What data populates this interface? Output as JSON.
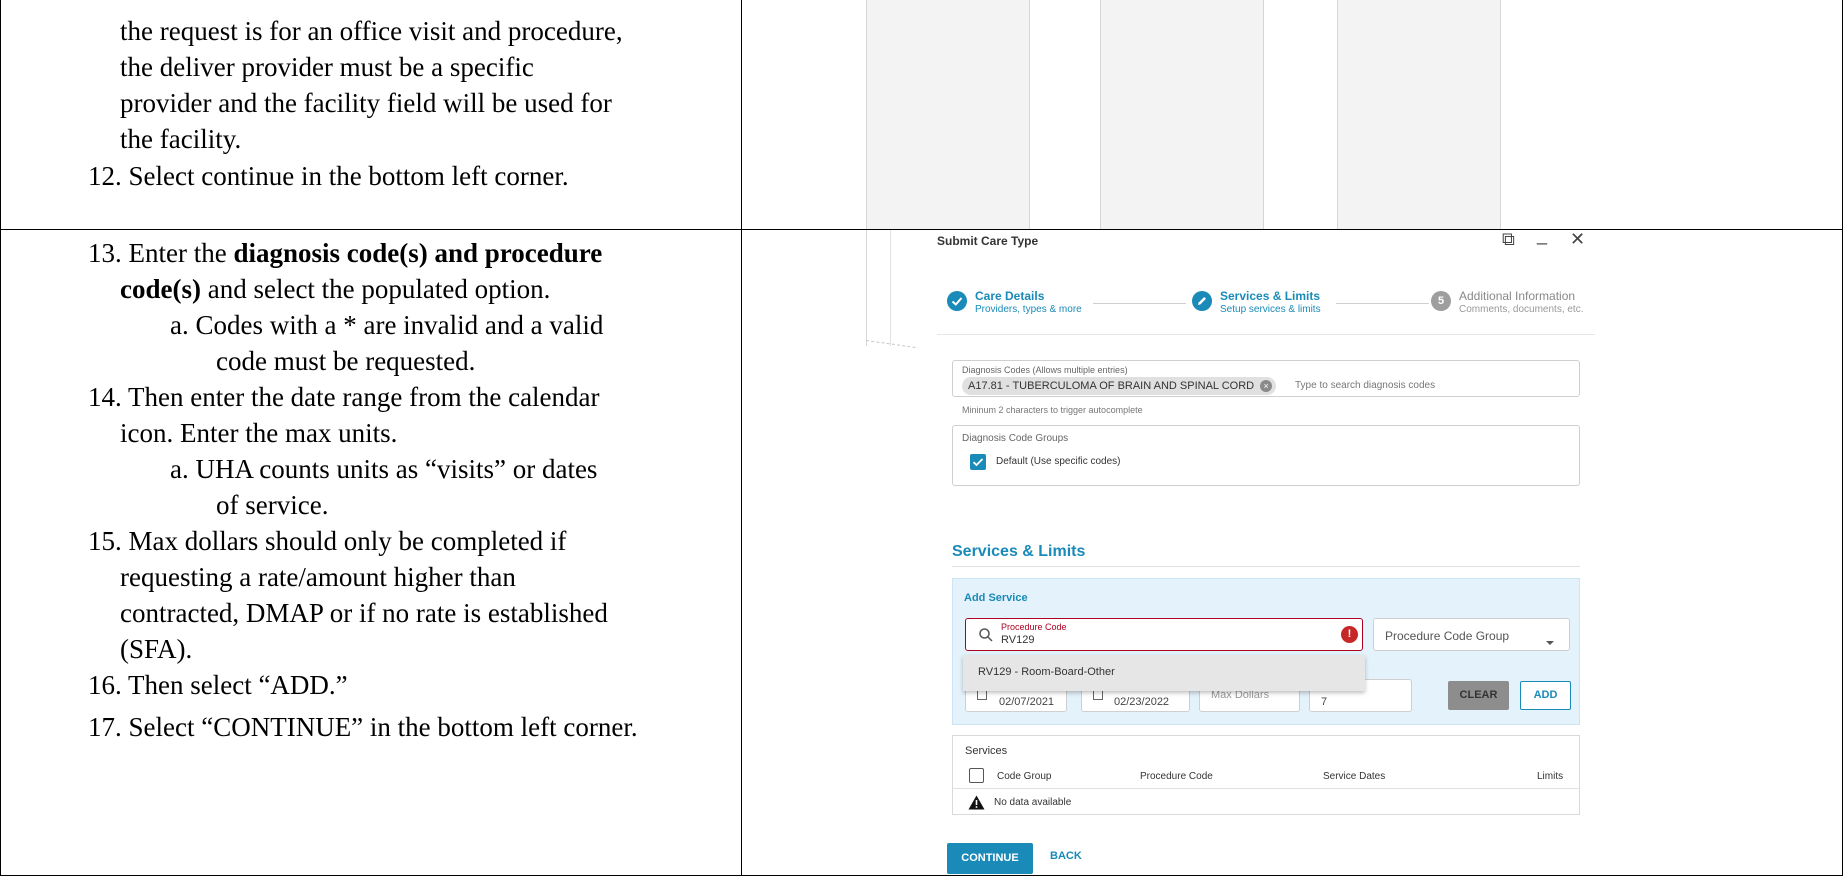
{
  "document": {
    "top_cell_lines": [
      "the request is for an office visit and procedure,",
      "the deliver provider must be a specific",
      "provider and the facility field will be used for",
      "the facility."
    ],
    "step12": "12. Select continue in the bottom left corner.",
    "step13": {
      "prefix": "13. Enter the ",
      "bold1": "diagnosis code(s) and procedure",
      "bold2": "code(s)",
      "rest": " and select the populated option."
    },
    "step13a": [
      "a.  Codes with a * are invalid and a valid",
      "code must be requested."
    ],
    "step14": [
      "14. Then enter the date range from the calendar",
      "icon. Enter the max units."
    ],
    "step14a": [
      "a.  UHA counts units as “visits” or dates",
      "of service."
    ],
    "step15": [
      "15. Max dollars should only be completed if",
      "requesting a rate/amount higher than",
      "contracted, DMAP or if no rate is established",
      "(SFA)."
    ],
    "step16": "16. Then select “ADD.”",
    "step17": "17. Select “CONTINUE” in the bottom left corner."
  },
  "dialog": {
    "title": "Submit Care Type",
    "controls": {
      "popout": "⧉",
      "minimize": "_",
      "close": "✕"
    },
    "steps": [
      {
        "title": "Care Details",
        "subtitle": "Providers, types & more"
      },
      {
        "title": "Services & Limits",
        "subtitle": "Setup services & limits"
      },
      {
        "number": "5",
        "title": "Additional Information",
        "subtitle": "Comments, documents, etc."
      }
    ],
    "diagnosis": {
      "label": "Diagnosis Codes (Allows multiple entries)",
      "chip": "A17.81 - TUBERCULOMA OF BRAIN AND SPINAL CORD",
      "placeholder": "Type to search diagnosis codes",
      "hint": "Mininum 2 characters to trigger autocomplete"
    },
    "code_groups": {
      "label": "Diagnosis Code Groups",
      "default_option": "Default (Use specific codes)"
    },
    "services_limits": {
      "title": "Services & Limits",
      "add_service": "Add Service",
      "procedure_label": "Procedure Code",
      "procedure_value": "RV129",
      "error_icon": "!",
      "group_placeholder": "Procedure Code Group",
      "suggestion": "RV129 - Room-Board-Other",
      "start_date": "02/07/2021",
      "end_date": "02/23/2022",
      "max_dollars_placeholder": "Max Dollars",
      "max_units_value": "7",
      "clear_label": "CLEAR",
      "add_label": "ADD"
    },
    "services_table": {
      "title": "Services",
      "columns": [
        "Code Group",
        "Procedure Code",
        "Service Dates",
        "Limits"
      ],
      "empty_text": "No data available"
    },
    "continue_label": "CONTINUE",
    "back_label": "BACK"
  }
}
